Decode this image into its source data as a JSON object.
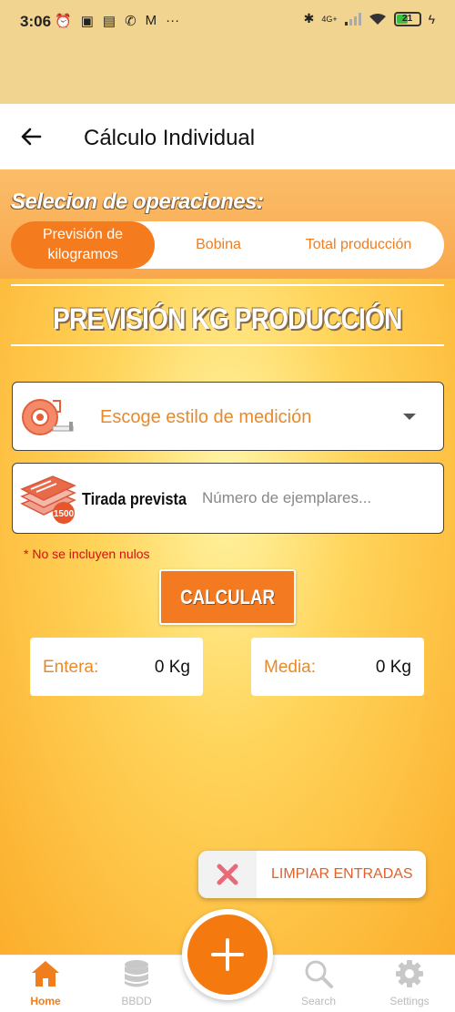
{
  "status_bar": {
    "time": "3:06",
    "battery": "21",
    "network": "4G+"
  },
  "app_bar": {
    "title": "Cálculo Individual"
  },
  "operations": {
    "label": "Selecion de operaciones:",
    "tabs": [
      {
        "label": "Previsión de kilogramos",
        "active": true
      },
      {
        "label": "Bobina",
        "active": false
      },
      {
        "label": "Total producción",
        "active": false
      }
    ]
  },
  "form": {
    "banner_title": "PREVISIÓN KG PRODUCCIÓN",
    "measure_select": {
      "value": "Escoge estilo de medición"
    },
    "tirada": {
      "icon_text": "1500",
      "label": "Tirada prevista",
      "placeholder": "Número de ejemplares...",
      "value": ""
    },
    "note": "* No se incluyen nulos",
    "calculate_label": "CALCULAR",
    "results": [
      {
        "label": "Entera:",
        "value": "0 Kg"
      },
      {
        "label": "Media:",
        "value": "0 Kg"
      }
    ],
    "clear_label": "LIMPIAR ENTRADAS"
  },
  "bottom_nav": {
    "items": [
      {
        "label": "Home",
        "active": true
      },
      {
        "label": "BBDD",
        "active": false
      },
      {
        "label": "Search",
        "active": false
      },
      {
        "label": "Settings",
        "active": false
      }
    ]
  },
  "colors": {
    "accent": "#f47a22",
    "header_bg": "#f1d48f",
    "error": "#d01010"
  }
}
